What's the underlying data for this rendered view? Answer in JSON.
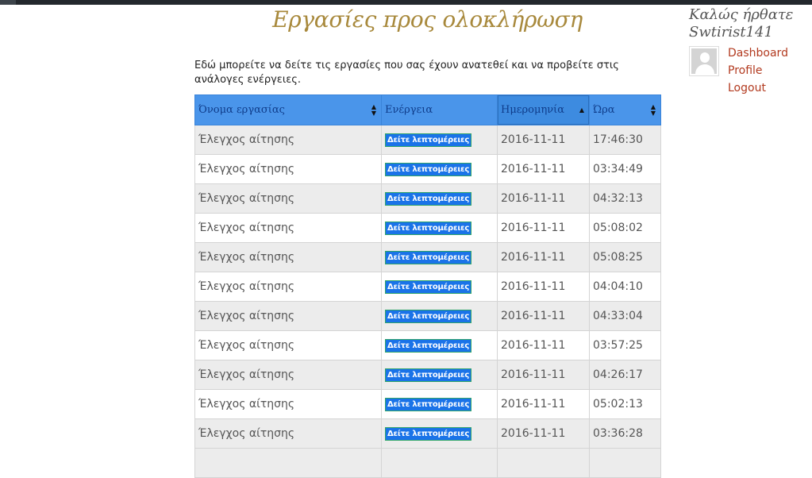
{
  "page": {
    "title": "Εργασίες προς ολοκλήρωση",
    "intro": "Εδώ μπορείτε να δείτε τις εργασίες που σας έχουν ανατεθεί και να προβείτε στις ανάλογες ενέργειες."
  },
  "sidebar": {
    "welcome_line1": "Καλώς ήρθατε",
    "welcome_line2": "Swtirist141",
    "links": {
      "dashboard": "Dashboard",
      "profile": "Profile",
      "logout": "Logout"
    }
  },
  "table": {
    "headers": {
      "name": "Όνομα εργασίας",
      "action": "Ενέργεια",
      "date": "Ημερομηνία",
      "time": "Ώρα"
    },
    "sorted_column": "date",
    "button_label": "Δείτε λεπτομέρειες",
    "rows": [
      {
        "name": "Έλεγχος αίτησης",
        "date": "2016-11-11",
        "time": "17:46:30"
      },
      {
        "name": "Έλεγχος αίτησης",
        "date": "2016-11-11",
        "time": "03:34:49"
      },
      {
        "name": "Έλεγχος αίτησης",
        "date": "2016-11-11",
        "time": "04:32:13"
      },
      {
        "name": "Έλεγχος αίτησης",
        "date": "2016-11-11",
        "time": "05:08:02"
      },
      {
        "name": "Έλεγχος αίτησης",
        "date": "2016-11-11",
        "time": "05:08:25"
      },
      {
        "name": "Έλεγχος αίτησης",
        "date": "2016-11-11",
        "time": "04:04:10"
      },
      {
        "name": "Έλεγχος αίτησης",
        "date": "2016-11-11",
        "time": "04:33:04"
      },
      {
        "name": "Έλεγχος αίτησης",
        "date": "2016-11-11",
        "time": "03:57:25"
      },
      {
        "name": "Έλεγχος αίτησης",
        "date": "2016-11-11",
        "time": "04:26:17"
      },
      {
        "name": "Έλεγχος αίτησης",
        "date": "2016-11-11",
        "time": "05:02:13"
      },
      {
        "name": "Έλεγχος αίτησης",
        "date": "2016-11-11",
        "time": "03:36:28"
      }
    ]
  },
  "colors": {
    "title": "#a8893c",
    "header_bg": "#4a95ea",
    "link": "#b23a1f",
    "button_bg": "#1a73e8"
  }
}
